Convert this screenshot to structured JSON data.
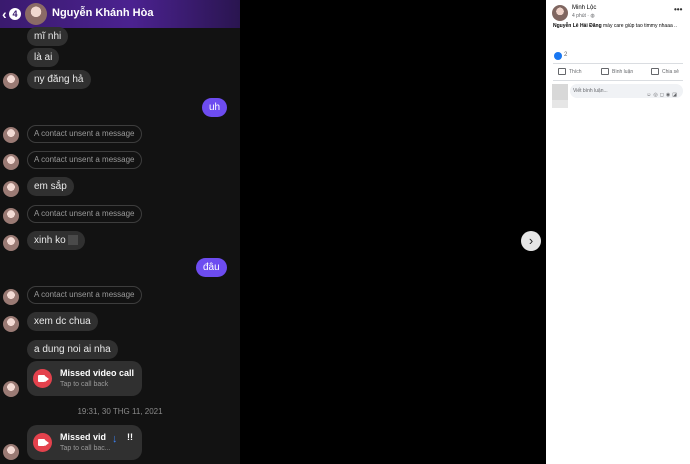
{
  "chat": {
    "back_badge": "4",
    "contact_name": "Nguyễn Khánh Hòa",
    "messages": {
      "m1": "mĩ nhi",
      "m2": "là ai",
      "m3": "ny đăng hả",
      "me1": "uh",
      "unsent": "A contact unsent a message",
      "m4": "em sắp",
      "m5": "xinh ko",
      "me2": "đâu",
      "m6": "xem dc chua",
      "m7": "a dung noi ai nha"
    },
    "call1": {
      "title": "Missed video call",
      "sub": "Tap to call back"
    },
    "timestamp": "19:31, 30 THG 11, 2021",
    "call2": {
      "title": "Missed vid",
      "sub": "Tap to call bac..."
    },
    "trailing": "!!"
  },
  "post": {
    "author": "Minh Lộc",
    "time": "4 phút · ",
    "tagged": "Nguyễn Lê Hải Đăng",
    "text": " mày care giúp tao timmy nhaaa ..",
    "reaction_count": "2",
    "like_label": "Thích",
    "comment_label": "Bình luận",
    "share_label": "Chia sẻ",
    "comment_placeholder": "Viết bình luận..."
  },
  "colors": {
    "header": "#4b2290",
    "my_bubble": "#6d4cf0",
    "missed_call": "#e4424d",
    "fb_blue": "#1877f2"
  }
}
